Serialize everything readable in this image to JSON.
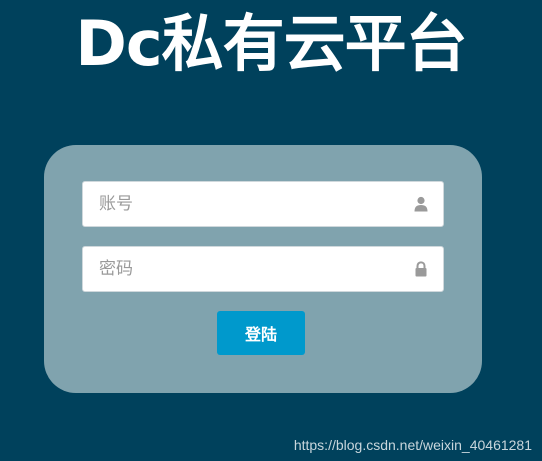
{
  "page": {
    "title": "Dc私有云平台"
  },
  "form": {
    "account_placeholder": "账号",
    "account_value": "",
    "password_placeholder": "密码",
    "password_value": "",
    "login_label": "登陆"
  },
  "icons": {
    "account": "user-icon",
    "password": "lock-icon"
  },
  "colors": {
    "background": "#00415c",
    "panel": "#80a3ae",
    "button": "#0099cc",
    "icon": "#9a9a9a"
  },
  "watermark": "https://blog.csdn.net/weixin_40461281"
}
